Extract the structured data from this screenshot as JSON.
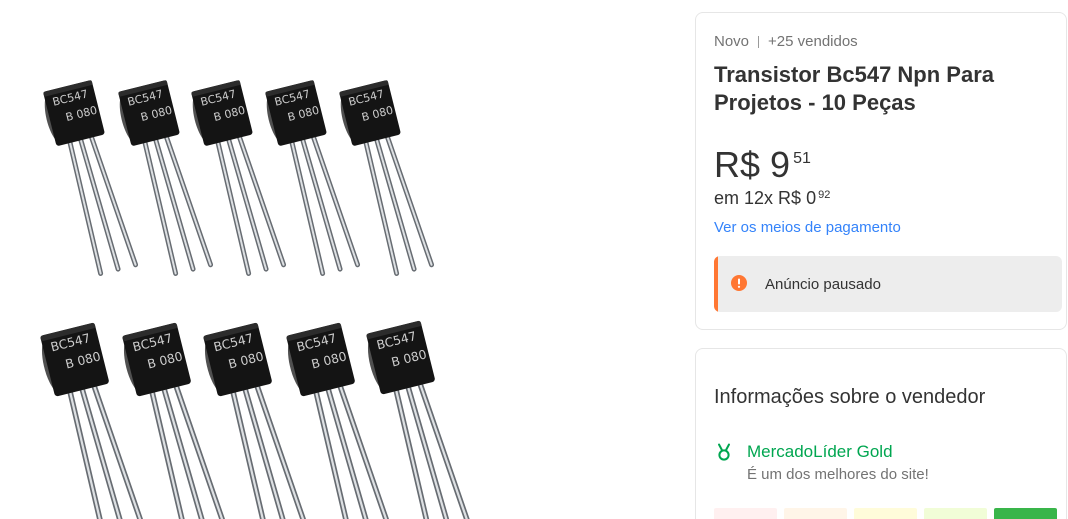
{
  "product": {
    "condition": "Novo",
    "sold_count": "+25 vendidos",
    "title": "Transistor Bc547 Npn Para Projetos - 10 Peças",
    "price": {
      "currency": "R$",
      "amount": "9",
      "cents": "51"
    },
    "installments": {
      "label": "em 12x",
      "currency": "R$",
      "amount": "0",
      "cents": "92"
    },
    "payment_methods_link": "Ver os meios de pagamento",
    "status": {
      "icon": "exclamation-circle-icon",
      "message": "Anúncio pausado"
    }
  },
  "product_image": {
    "marking_line1": "BC547",
    "marking_line2": "B 080"
  },
  "seller": {
    "section_title": "Informações sobre o vendedor",
    "badge": {
      "icon": "medal-icon",
      "label": "MercadoLíder Gold",
      "description": "É um dos melhores do site!"
    },
    "reputation": {
      "levels": 5,
      "active_level": 5,
      "level_colors": [
        "#fff0f0",
        "#fff5e8",
        "#fffcda",
        "#f1fdd7",
        "#39b54a"
      ]
    }
  },
  "colors": {
    "link": "#3483fa",
    "status_accent": "#ff7733",
    "seller_badge": "#00a650",
    "text_primary": "#333333",
    "text_secondary": "#737373",
    "alert_background": "#ededed",
    "card_border": "#e6e6e6"
  }
}
